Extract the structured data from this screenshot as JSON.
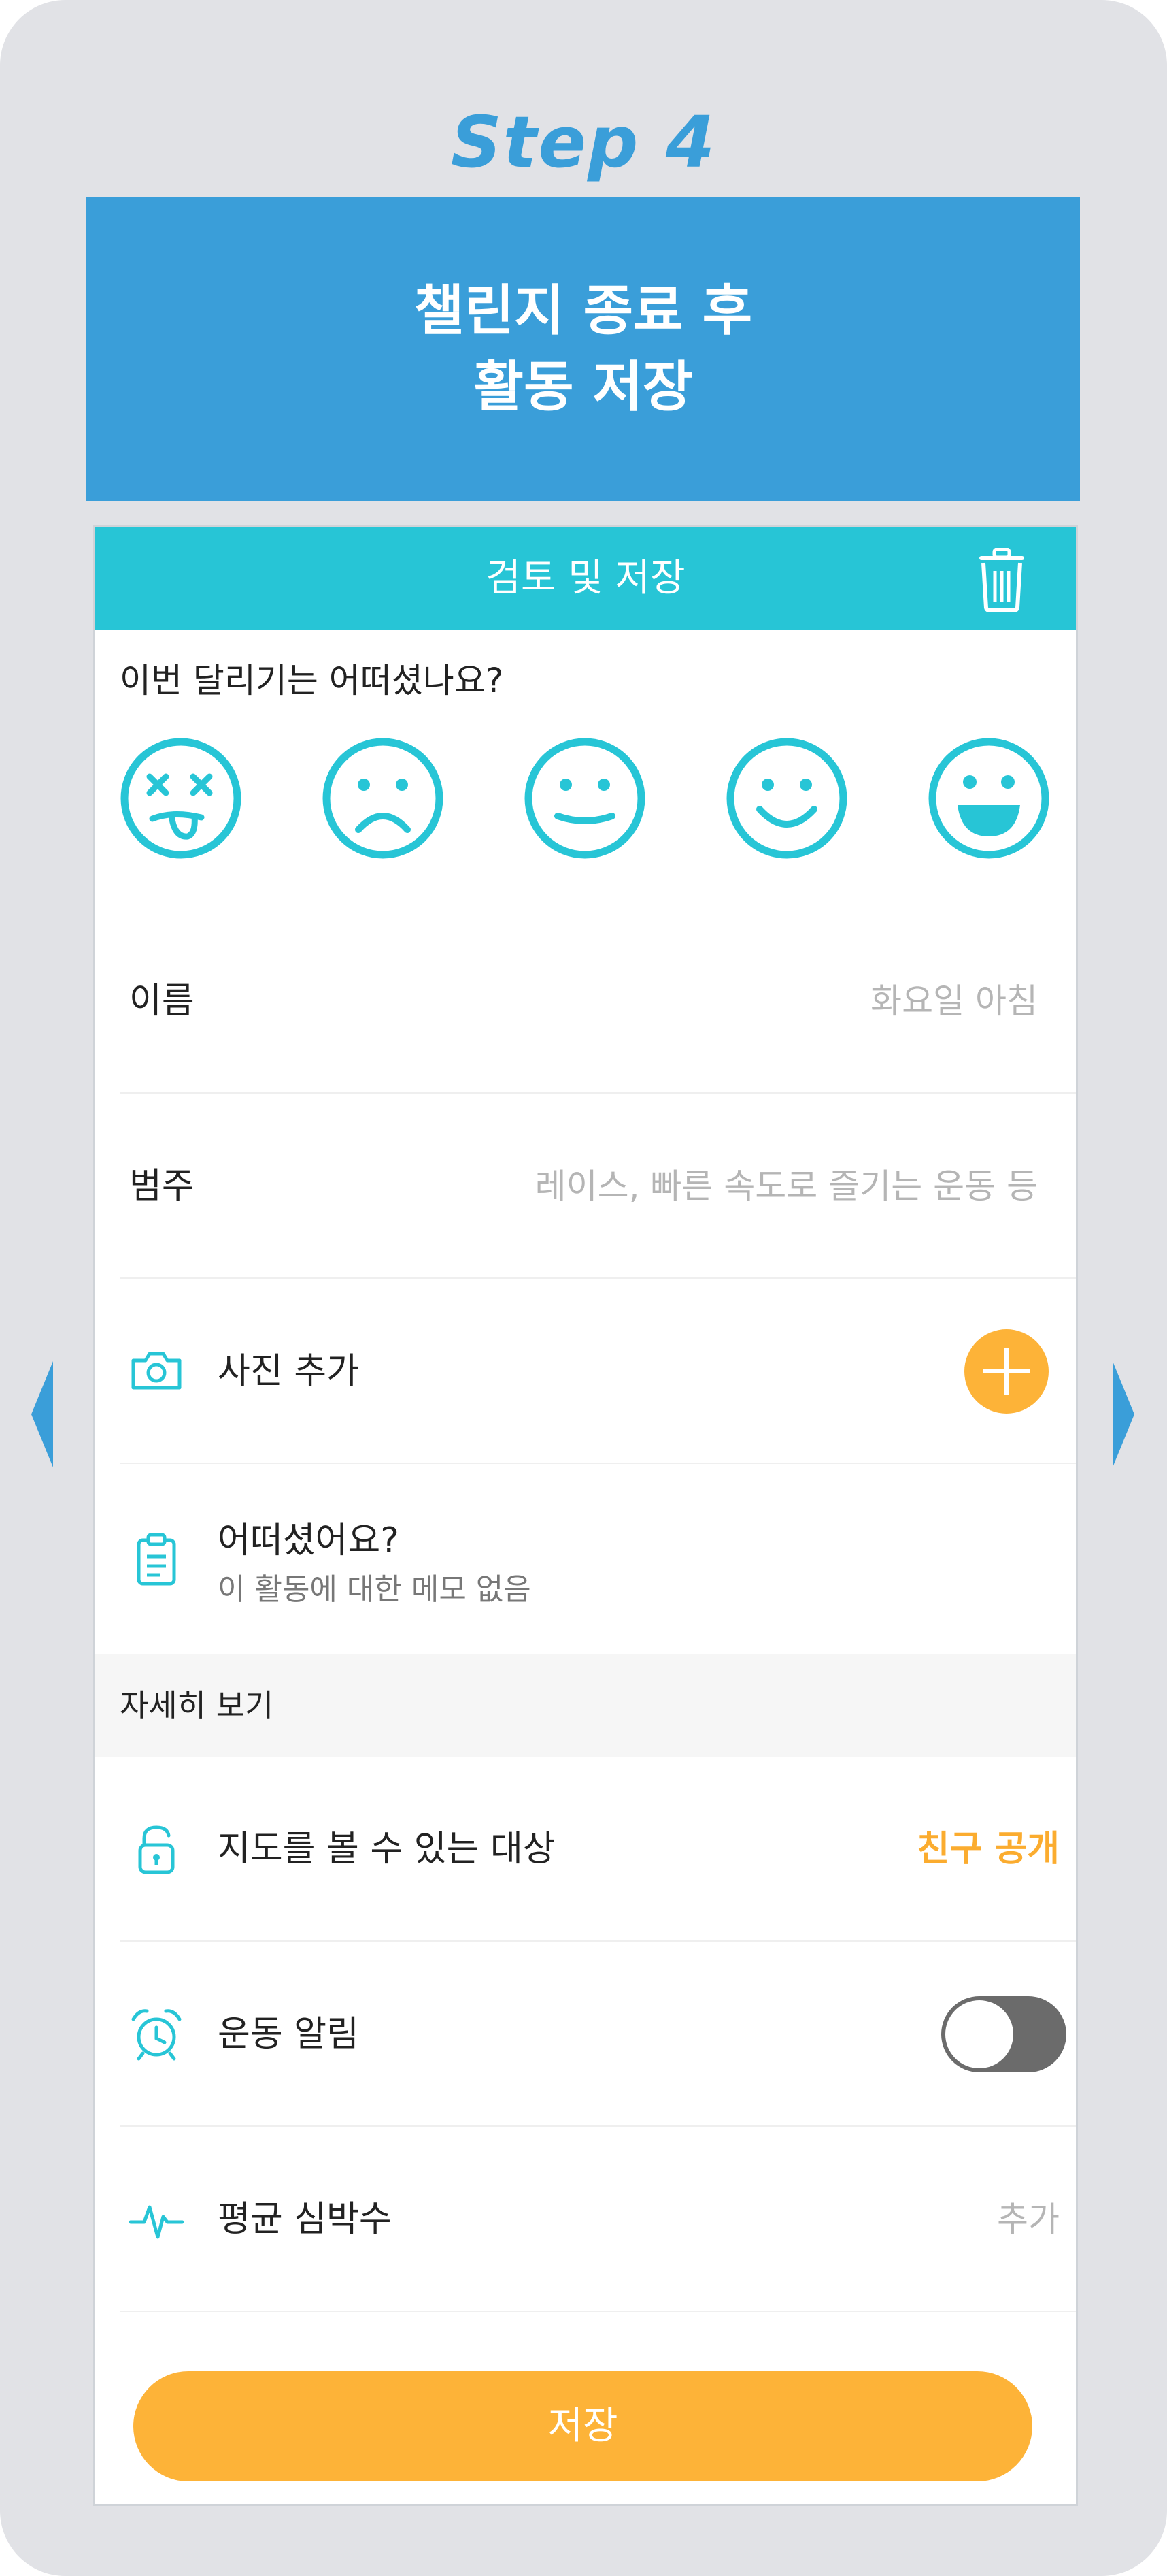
{
  "step_title": "Step 4",
  "banner": {
    "line1": "챌린지 종료 후",
    "line2": "활동 저장"
  },
  "phone": {
    "header_title": "검토 및 저장",
    "question": "이번 달리기는 어떠셨나요?",
    "faces": [
      "dizzy-face-icon",
      "sad-face-icon",
      "neutral-face-icon",
      "smile-face-icon",
      "laugh-face-icon"
    ],
    "name_row": {
      "label": "이름",
      "value": "화요일 아침"
    },
    "category_row": {
      "label": "범주",
      "value": "레이스, 빠른 속도로 즐기는 운동 등"
    },
    "photo_row": {
      "label": "사진 추가"
    },
    "memo_row": {
      "title": "어떠셨어요?",
      "subtitle": "이 활동에 대한 메모 없음"
    },
    "section_header": "자세히 보기",
    "map_row": {
      "label": "지도를 볼 수 있는 대상",
      "value": "친구 공개"
    },
    "alarm_row": {
      "label": "운동 알림",
      "toggle_on": false
    },
    "heart_row": {
      "label": "평균 심박수",
      "value": "추가"
    },
    "save_button": "저장"
  },
  "colors": {
    "brand_blue": "#3a9ed9",
    "teal": "#27c5d6",
    "orange": "#fdb338",
    "page_bg": "#e1e2e6"
  }
}
